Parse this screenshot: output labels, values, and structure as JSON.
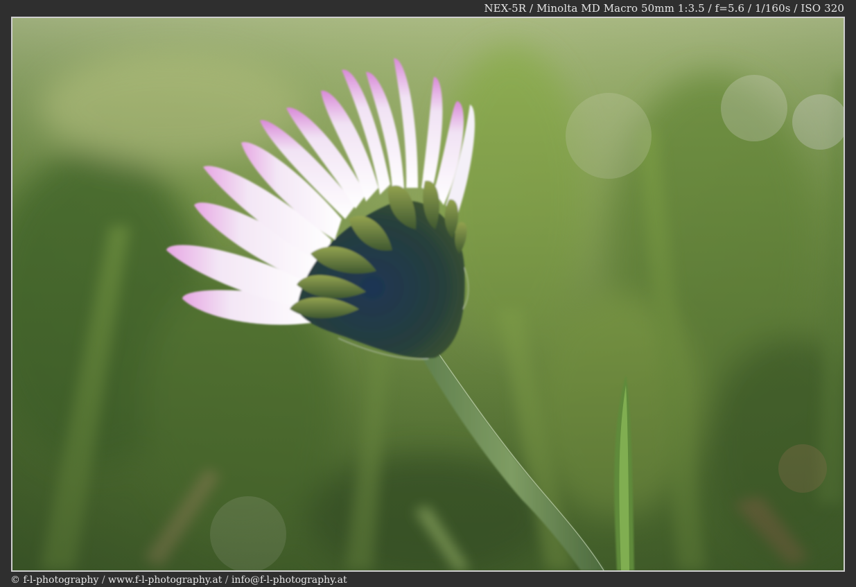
{
  "exif_caption": "NEX-5R / Minolta MD Macro 50mm 1:3.5 / f=5.6 / 1/160s / ISO 320",
  "credits": {
    "copyright": "© f-l-photography",
    "website": "www.f-l-photography.at",
    "email": "info@f-l-photography.at",
    "separator": "/"
  },
  "colors": {
    "page_background": "#2f2f2f",
    "frame_border": "#cfcfcf",
    "text": "#e6e6e6"
  }
}
